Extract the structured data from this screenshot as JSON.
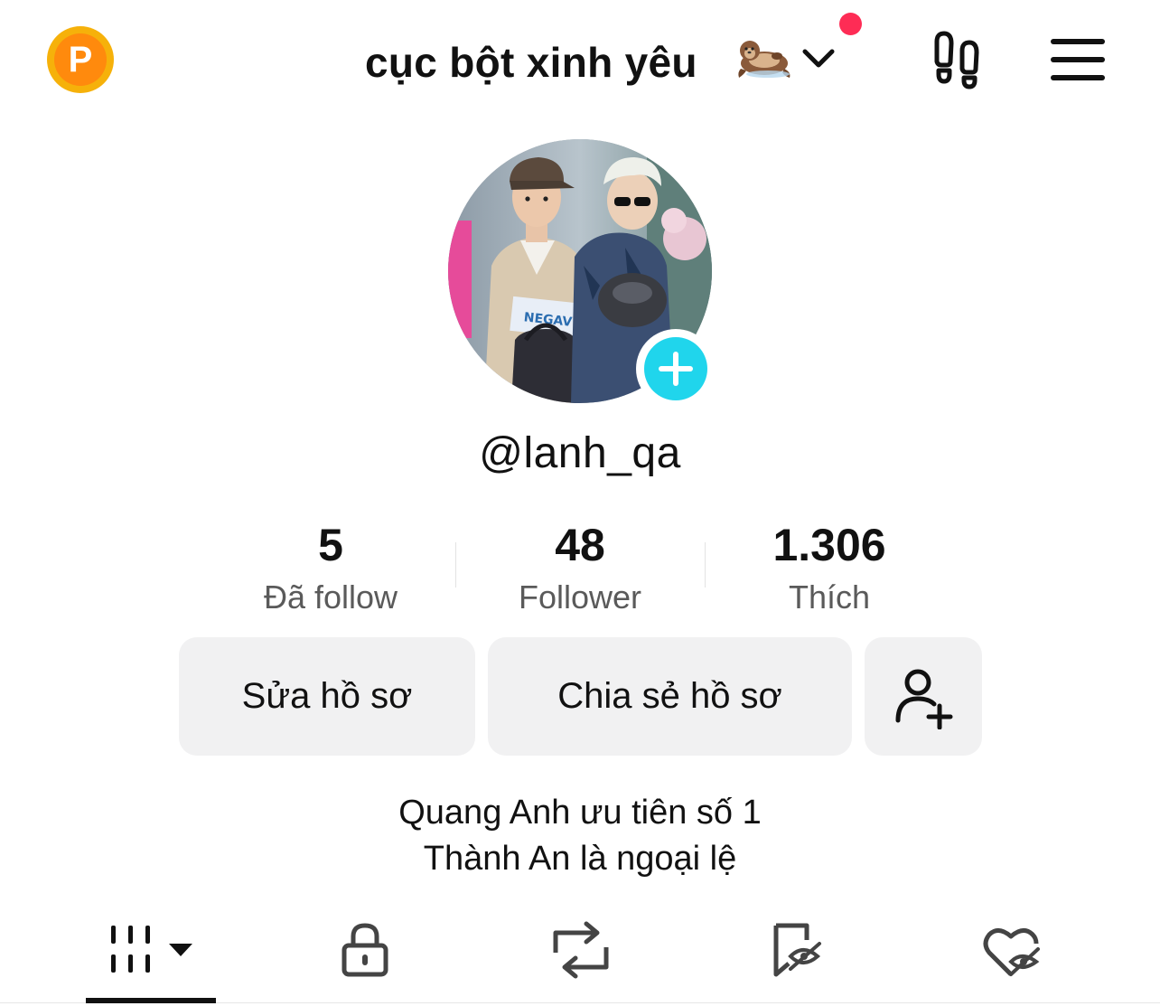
{
  "header": {
    "coin_letter": "P",
    "account_name": "cục bột xinh yêu",
    "account_emoji_icon": "otter-emoji-icon",
    "dropdown_icon": "chevron-down-icon",
    "footprint_icon": "footprints-icon",
    "menu_icon": "hamburger-menu-icon",
    "notification_color": "#fe2c55"
  },
  "profile": {
    "username": "@lanh_qa",
    "avatar_badge_icon": "plus-icon",
    "avatar_badge_color": "#20d5ec"
  },
  "stats": [
    {
      "value": "5",
      "label": "Đã follow"
    },
    {
      "value": "48",
      "label": "Follower"
    },
    {
      "value": "1.306",
      "label": "Thích"
    }
  ],
  "actions": {
    "edit_profile": "Sửa hồ sơ",
    "share_profile": "Chia sẻ hồ sơ",
    "add_friend_icon": "add-user-icon"
  },
  "bio": {
    "line1": "Quang Anh ưu tiên số 1",
    "line2": "Thành An là ngoại lệ"
  },
  "tabs": [
    {
      "icon": "grid-dropdown-icon",
      "active": true
    },
    {
      "icon": "lock-icon",
      "active": false
    },
    {
      "icon": "repost-icon",
      "active": false
    },
    {
      "icon": "bookmark-hidden-icon",
      "active": false
    },
    {
      "icon": "heart-hidden-icon",
      "active": false
    }
  ]
}
